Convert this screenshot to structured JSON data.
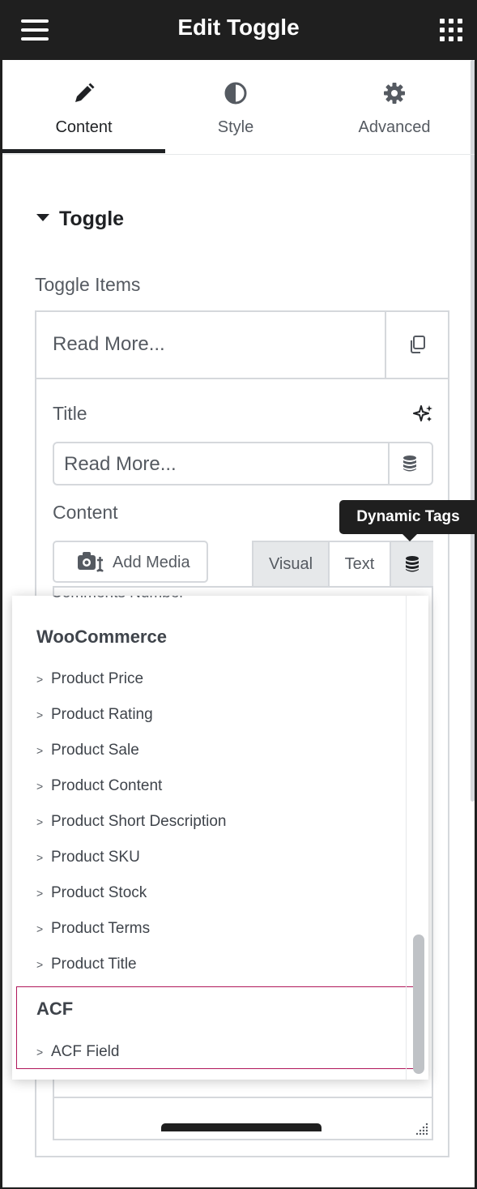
{
  "header": {
    "title": "Edit Toggle",
    "menu_icon": "hamburger-icon",
    "apps_icon": "grid-icon"
  },
  "tabs": [
    {
      "label": "Content",
      "icon": "pencil-icon",
      "active": true
    },
    {
      "label": "Style",
      "icon": "half-circle-icon",
      "active": false
    },
    {
      "label": "Advanced",
      "icon": "gear-icon",
      "active": false
    }
  ],
  "section": {
    "title": "Toggle"
  },
  "repeater": {
    "label": "Toggle Items",
    "item_title": "Read More...",
    "title_field_label": "Title",
    "title_value": "Read More...",
    "content_field_label": "Content",
    "add_media_label": "Add Media",
    "editor_tabs": [
      "Visual",
      "Text"
    ]
  },
  "tooltip": {
    "text": "Dynamic Tags"
  },
  "dropdown": {
    "clipped_item": "Comments Number",
    "groups": [
      {
        "name": "WooCommerce",
        "items": [
          "Product Price",
          "Product Rating",
          "Product Sale",
          "Product Content",
          "Product Short Description",
          "Product SKU",
          "Product Stock",
          "Product Terms",
          "Product Title"
        ]
      },
      {
        "name": "ACF",
        "items": [
          "ACF Field"
        ]
      }
    ],
    "item_marker": ">"
  },
  "colors": {
    "accent_highlight": "#b0175a",
    "header_bg": "#1f1f1f"
  }
}
